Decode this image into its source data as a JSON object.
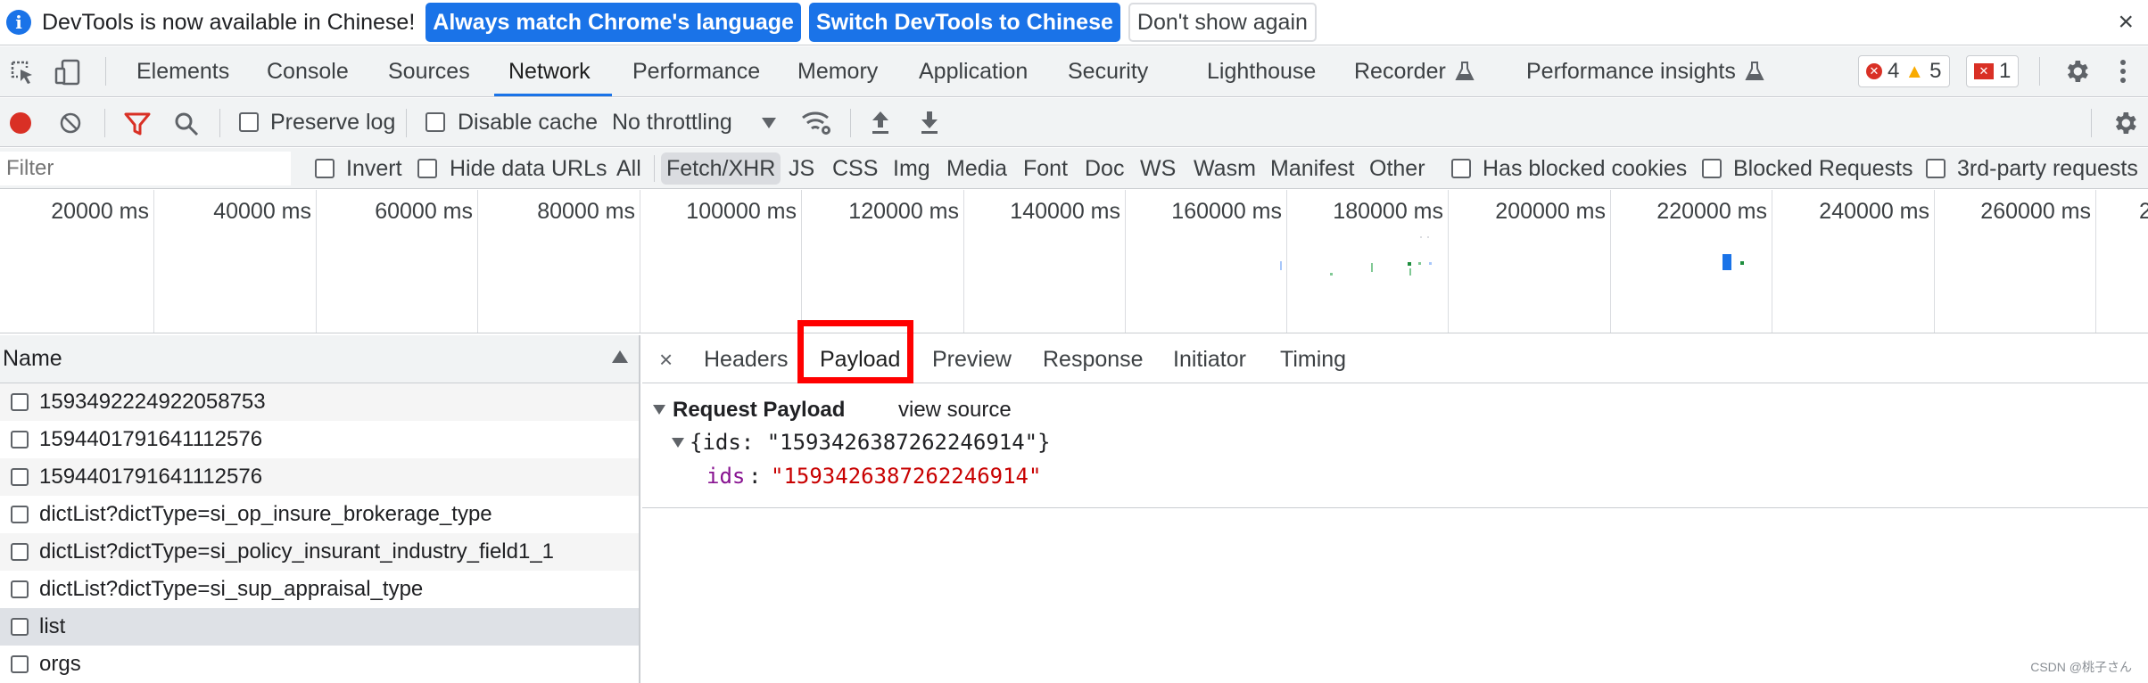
{
  "infobar": {
    "message": "DevTools is now available in Chinese!",
    "btn_match": "Always match Chrome's language",
    "btn_switch": "Switch DevTools to Chinese",
    "btn_dont_show": "Don't show again",
    "close": "×"
  },
  "tabs": {
    "elements": "Elements",
    "console": "Console",
    "sources": "Sources",
    "network": "Network",
    "performance": "Performance",
    "memory": "Memory",
    "application": "Application",
    "security": "Security",
    "lighthouse": "Lighthouse",
    "recorder": "Recorder",
    "perf_insights": "Performance insights",
    "errors": "4",
    "warnings": "5",
    "issues": "1"
  },
  "toolbar": {
    "preserve_log": "Preserve log",
    "disable_cache": "Disable cache",
    "throttling": "No throttling"
  },
  "filter": {
    "placeholder": "Filter",
    "invert": "Invert",
    "hide_data_urls": "Hide data URLs",
    "types": [
      "All",
      "Fetch/XHR",
      "JS",
      "CSS",
      "Img",
      "Media",
      "Font",
      "Doc",
      "WS",
      "Wasm",
      "Manifest",
      "Other"
    ],
    "selected_type": "Fetch/XHR",
    "has_blocked_cookies": "Has blocked cookies",
    "blocked_requests": "Blocked Requests",
    "third_party": "3rd-party requests"
  },
  "overview": {
    "ticks": [
      "20000 ms",
      "40000 ms",
      "60000 ms",
      "80000 ms",
      "100000 ms",
      "120000 ms",
      "140000 ms",
      "160000 ms",
      "180000 ms",
      "200000 ms",
      "220000 ms",
      "240000 ms",
      "260000 ms",
      "2"
    ]
  },
  "requests": {
    "header": "Name",
    "rows": [
      "1593492224922058753",
      "1594401791641112576",
      "1594401791641112576",
      "dictList?dictType=si_op_insure_brokerage_type",
      "dictList?dictType=si_policy_insurant_industry_field1_1",
      "dictList?dictType=si_sup_appraisal_type",
      "list",
      "orgs"
    ],
    "selected_index": 6
  },
  "detail": {
    "close": "×",
    "tabs": [
      "Headers",
      "Payload",
      "Preview",
      "Response",
      "Initiator",
      "Timing"
    ],
    "active_tab": "Payload",
    "section_title": "Request Payload",
    "view_source": "view source",
    "summary": "{ids: \"1593426387262246914\"}",
    "key": "ids",
    "value": "\"1593426387262246914\""
  },
  "watermark": "CSDN @桃子さん",
  "colors": {
    "accent": "#1a73e8",
    "highlight": "#ff0000",
    "record": "#d93025"
  }
}
